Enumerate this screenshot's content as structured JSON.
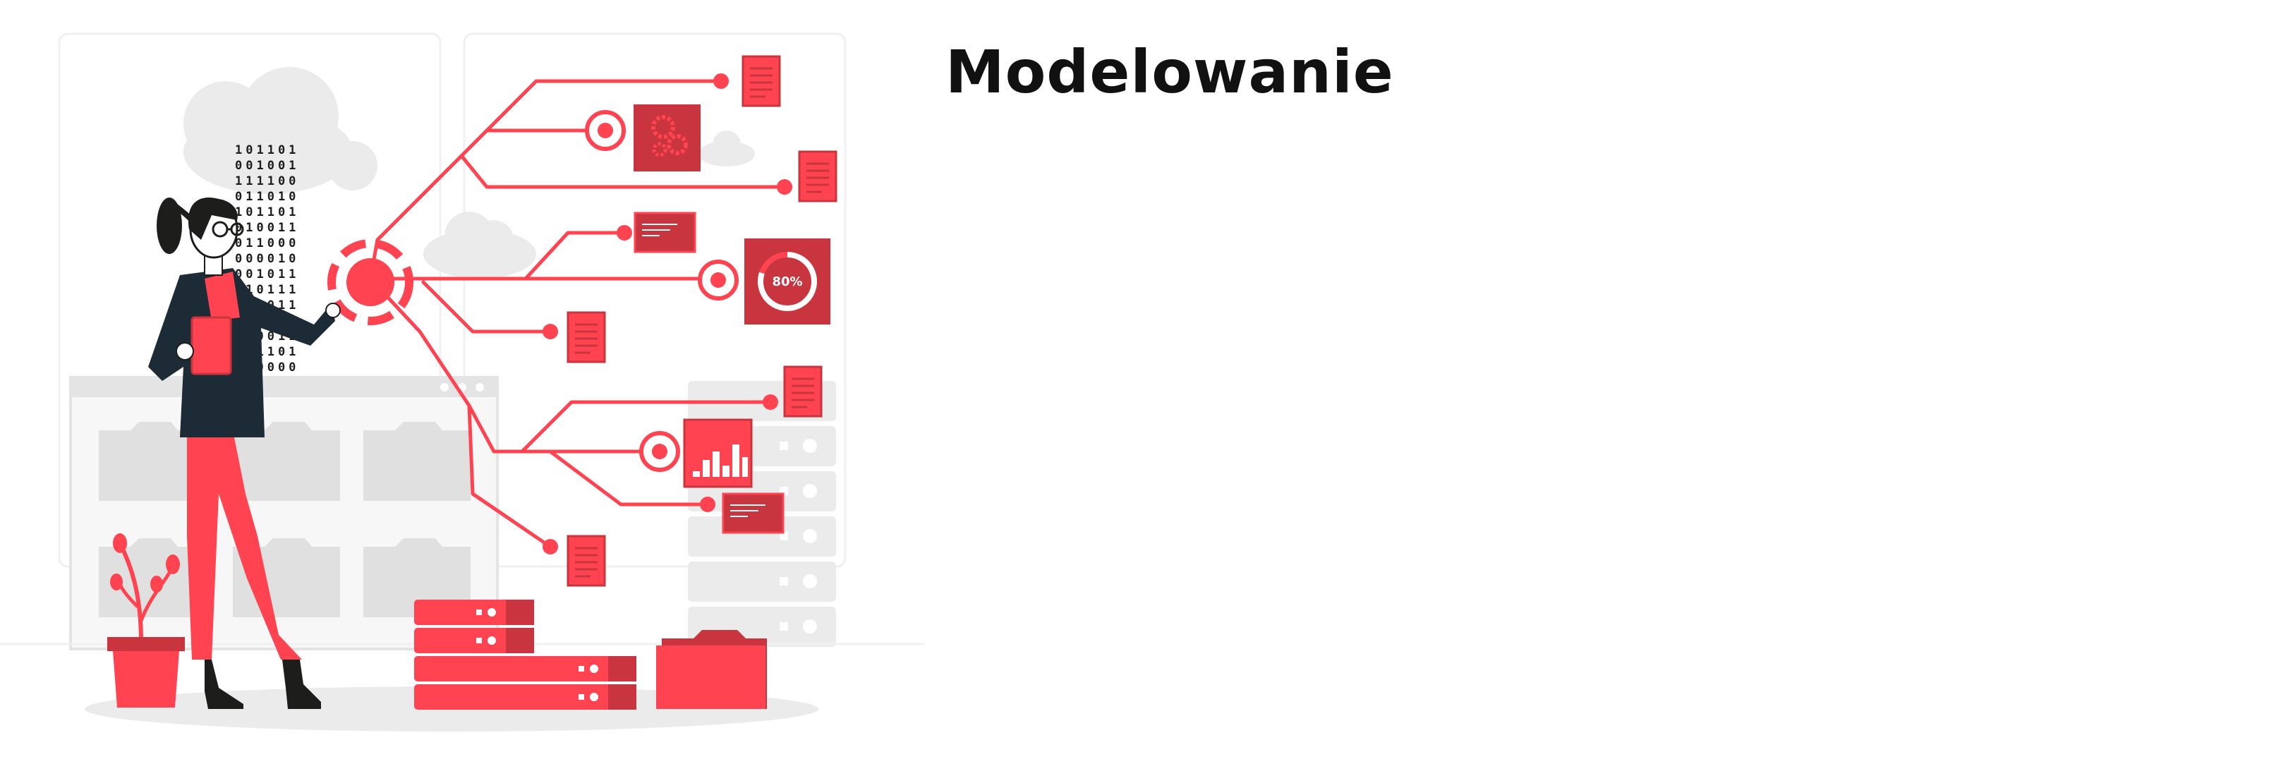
{
  "page": {
    "title": "Modelowanie"
  },
  "illustration": {
    "gauge_label": "80%",
    "binary_rows": [
      "101101",
      "001001",
      "111100",
      "011010",
      "101101",
      "010011",
      "011000",
      "000010",
      "001011",
      "110111",
      "101011",
      "001100",
      "110011",
      "101101",
      "010000",
      "011101"
    ],
    "colors": {
      "accent": "#ff4350",
      "accent_dark": "#c9353e",
      "ink": "#1d2b36",
      "light_gray": "#ebebeb",
      "mid_gray": "#dcdcdc"
    }
  }
}
